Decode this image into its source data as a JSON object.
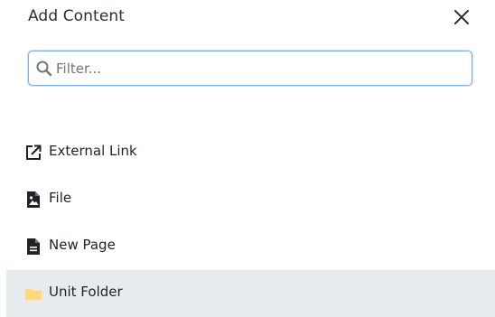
{
  "dialog": {
    "title": "Add Content",
    "close_icon": "close-icon"
  },
  "filter": {
    "placeholder": "Filter...",
    "value": "",
    "icon": "search-icon"
  },
  "items": [
    {
      "label": "External Link",
      "icon": "external-link-icon",
      "selected": false
    },
    {
      "label": "File",
      "icon": "file-image-icon",
      "selected": false
    },
    {
      "label": "New Page",
      "icon": "page-icon",
      "selected": false
    },
    {
      "label": "Unit Folder",
      "icon": "folder-icon",
      "selected": true,
      "icon_color": "#ffd97a"
    }
  ],
  "colors": {
    "selected_row": "#e8ebee",
    "input_border": "#7eb0dd",
    "text": "#1f2328"
  }
}
